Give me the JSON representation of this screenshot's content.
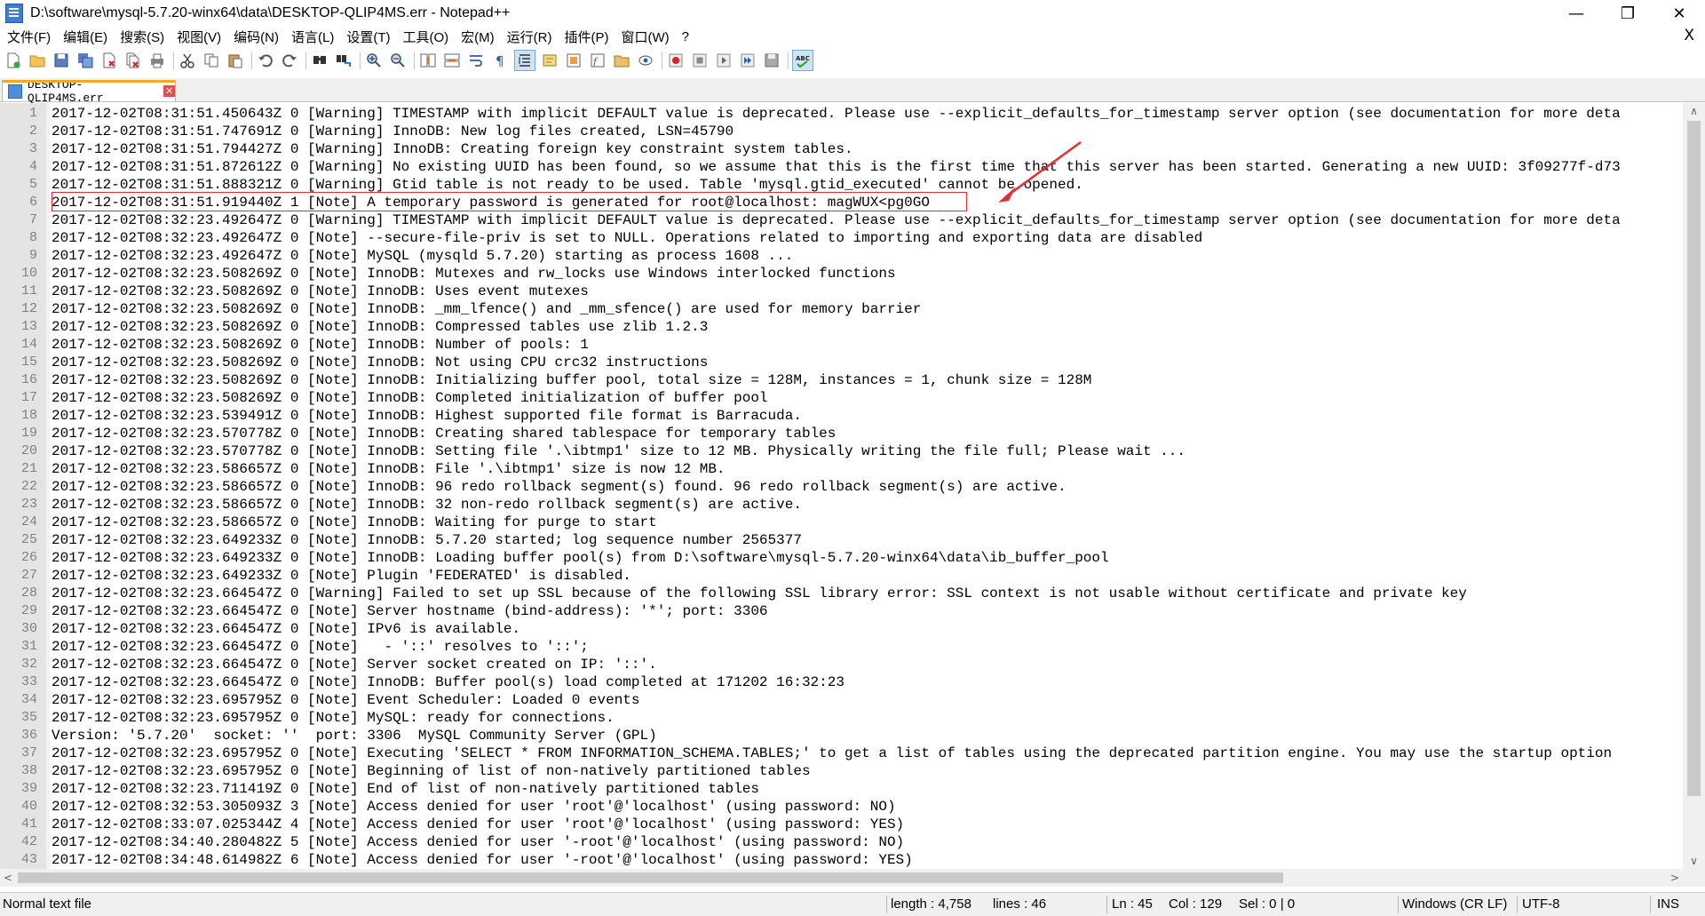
{
  "window": {
    "title": "D:\\software\\mysql-5.7.20-winx64\\data\\DESKTOP-QLIP4MS.err - Notepad++",
    "minimize": "—",
    "restore": "❐",
    "close": "✕",
    "menubar_close": "X"
  },
  "menu": [
    "文件(F)",
    "编辑(E)",
    "搜索(S)",
    "视图(V)",
    "编码(N)",
    "语言(L)",
    "设置(T)",
    "工具(O)",
    "宏(M)",
    "运行(R)",
    "插件(P)",
    "窗口(W)",
    "?"
  ],
  "toolbar": {
    "icons": [
      "new-file-icon",
      "open-file-icon",
      "save-icon",
      "save-all-icon",
      "close-icon",
      "close-all-icon",
      "print-icon",
      "cut-icon",
      "copy-icon",
      "paste-icon",
      "undo-icon",
      "redo-icon",
      "find-icon",
      "replace-icon",
      "zoom-in-icon",
      "zoom-out-icon",
      "sync-vertical-icon",
      "sync-horizontal-icon",
      "word-wrap-icon",
      "show-all-chars-icon",
      "indent-guide-icon",
      "user-lang-icon",
      "doc-map-icon",
      "function-list-icon",
      "folder-workspace-icon",
      "monitoring-icon",
      "record-macro-icon",
      "stop-macro-icon",
      "play-macro-icon",
      "run-macro-multiple-icon",
      "save-macro-icon",
      "spell-check-icon"
    ]
  },
  "tab": {
    "label": "DESKTOP-QLIP4MS.err",
    "close": "✕"
  },
  "editor": {
    "lines": [
      "2017-12-02T08:31:51.450643Z 0 [Warning] TIMESTAMP with implicit DEFAULT value is deprecated. Please use --explicit_defaults_for_timestamp server option (see documentation for more deta",
      "2017-12-02T08:31:51.747691Z 0 [Warning] InnoDB: New log files created, LSN=45790",
      "2017-12-02T08:31:51.794427Z 0 [Warning] InnoDB: Creating foreign key constraint system tables.",
      "2017-12-02T08:31:51.872612Z 0 [Warning] No existing UUID has been found, so we assume that this is the first time that this server has been started. Generating a new UUID: 3f09277f-d73",
      "2017-12-02T08:31:51.888321Z 0 [Warning] Gtid table is not ready to be used. Table 'mysql.gtid_executed' cannot be opened.",
      "2017-12-02T08:31:51.919440Z 1 [Note] A temporary password is generated for root@localhost: magWUX<pg0GO",
      "2017-12-02T08:32:23.492647Z 0 [Warning] TIMESTAMP with implicit DEFAULT value is deprecated. Please use --explicit_defaults_for_timestamp server option (see documentation for more deta",
      "2017-12-02T08:32:23.492647Z 0 [Note] --secure-file-priv is set to NULL. Operations related to importing and exporting data are disabled",
      "2017-12-02T08:32:23.492647Z 0 [Note] MySQL (mysqld 5.7.20) starting as process 1608 ...",
      "2017-12-02T08:32:23.508269Z 0 [Note] InnoDB: Mutexes and rw_locks use Windows interlocked functions",
      "2017-12-02T08:32:23.508269Z 0 [Note] InnoDB: Uses event mutexes",
      "2017-12-02T08:32:23.508269Z 0 [Note] InnoDB: _mm_lfence() and _mm_sfence() are used for memory barrier",
      "2017-12-02T08:32:23.508269Z 0 [Note] InnoDB: Compressed tables use zlib 1.2.3",
      "2017-12-02T08:32:23.508269Z 0 [Note] InnoDB: Number of pools: 1",
      "2017-12-02T08:32:23.508269Z 0 [Note] InnoDB: Not using CPU crc32 instructions",
      "2017-12-02T08:32:23.508269Z 0 [Note] InnoDB: Initializing buffer pool, total size = 128M, instances = 1, chunk size = 128M",
      "2017-12-02T08:32:23.508269Z 0 [Note] InnoDB: Completed initialization of buffer pool",
      "2017-12-02T08:32:23.539491Z 0 [Note] InnoDB: Highest supported file format is Barracuda.",
      "2017-12-02T08:32:23.570778Z 0 [Note] InnoDB: Creating shared tablespace for temporary tables",
      "2017-12-02T08:32:23.570778Z 0 [Note] InnoDB: Setting file '.\\ibtmp1' size to 12 MB. Physically writing the file full; Please wait ...",
      "2017-12-02T08:32:23.586657Z 0 [Note] InnoDB: File '.\\ibtmp1' size is now 12 MB.",
      "2017-12-02T08:32:23.586657Z 0 [Note] InnoDB: 96 redo rollback segment(s) found. 96 redo rollback segment(s) are active.",
      "2017-12-02T08:32:23.586657Z 0 [Note] InnoDB: 32 non-redo rollback segment(s) are active.",
      "2017-12-02T08:32:23.586657Z 0 [Note] InnoDB: Waiting for purge to start",
      "2017-12-02T08:32:23.649233Z 0 [Note] InnoDB: 5.7.20 started; log sequence number 2565377",
      "2017-12-02T08:32:23.649233Z 0 [Note] InnoDB: Loading buffer pool(s) from D:\\software\\mysql-5.7.20-winx64\\data\\ib_buffer_pool",
      "2017-12-02T08:32:23.649233Z 0 [Note] Plugin 'FEDERATED' is disabled.",
      "2017-12-02T08:32:23.664547Z 0 [Warning] Failed to set up SSL because of the following SSL library error: SSL context is not usable without certificate and private key",
      "2017-12-02T08:32:23.664547Z 0 [Note] Server hostname (bind-address): '*'; port: 3306",
      "2017-12-02T08:32:23.664547Z 0 [Note] IPv6 is available.",
      "2017-12-02T08:32:23.664547Z 0 [Note]   - '::' resolves to '::';",
      "2017-12-02T08:32:23.664547Z 0 [Note] Server socket created on IP: '::'.",
      "2017-12-02T08:32:23.664547Z 0 [Note] InnoDB: Buffer pool(s) load completed at 171202 16:32:23",
      "2017-12-02T08:32:23.695795Z 0 [Note] Event Scheduler: Loaded 0 events",
      "2017-12-02T08:32:23.695795Z 0 [Note] MySQL: ready for connections.",
      "Version: '5.7.20'  socket: ''  port: 3306  MySQL Community Server (GPL)",
      "2017-12-02T08:32:23.695795Z 0 [Note] Executing 'SELECT * FROM INFORMATION_SCHEMA.TABLES;' to get a list of tables using the deprecated partition engine. You may use the startup option",
      "2017-12-02T08:32:23.695795Z 0 [Note] Beginning of list of non-natively partitioned tables",
      "2017-12-02T08:32:23.711419Z 0 [Note] End of list of non-natively partitioned tables",
      "2017-12-02T08:32:53.305093Z 3 [Note] Access denied for user 'root'@'localhost' (using password: NO)",
      "2017-12-02T08:33:07.025344Z 4 [Note] Access denied for user 'root'@'localhost' (using password: YES)",
      "2017-12-02T08:34:40.280482Z 5 [Note] Access denied for user '-root'@'localhost' (using password: NO)",
      "2017-12-02T08:34:48.614982Z 6 [Note] Access denied for user '-root'@'localhost' (using password: YES)"
    ],
    "highlight_color": "#e03030"
  },
  "scroll": {
    "up": "∧",
    "down": "∨",
    "left": "<",
    "right": ">"
  },
  "status": {
    "type": "Normal text file",
    "length": "length : 4,758",
    "lines": "lines : 46",
    "ln": "Ln : 45",
    "col": "Col : 129",
    "sel": "Sel : 0 | 0",
    "eol": "Windows (CR LF)",
    "encoding": "UTF-8",
    "mode": "INS"
  }
}
